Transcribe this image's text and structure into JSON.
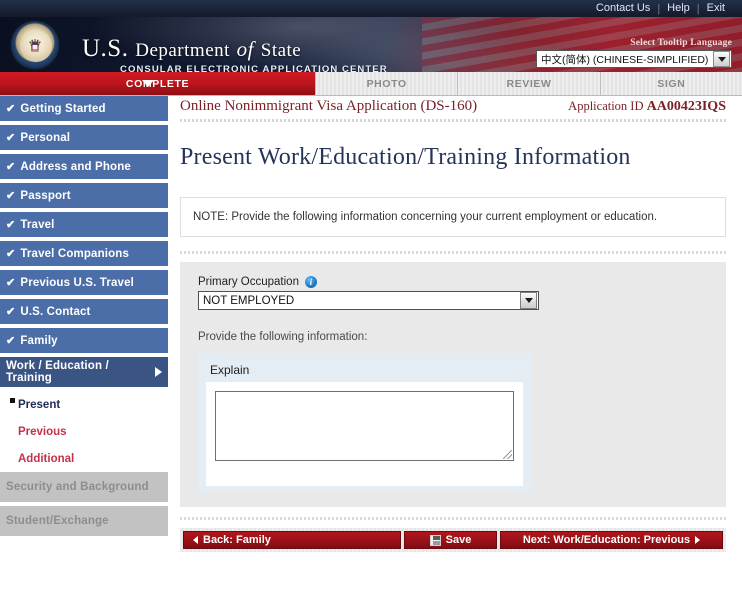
{
  "utility_links": [
    "Contact Us",
    "Help",
    "Exit"
  ],
  "banner": {
    "dept_us": "U.S.",
    "dept_department": "Department",
    "dept_of": "of",
    "dept_state": "State",
    "subtitle": "CONSULAR ELECTRONIC APPLICATION CENTER",
    "tooltip_language_label": "Select Tooltip Language",
    "tooltip_language_value": "中文(简体) (CHINESE-SIMPLIFIED)"
  },
  "stages": [
    {
      "label": "COMPLETE",
      "active": true
    },
    {
      "label": "PHOTO",
      "active": false
    },
    {
      "label": "REVIEW",
      "active": false
    },
    {
      "label": "SIGN",
      "active": false
    }
  ],
  "sidebar": {
    "items": [
      {
        "label": "Getting Started",
        "state": "complete"
      },
      {
        "label": "Personal",
        "state": "complete"
      },
      {
        "label": "Address and Phone",
        "state": "complete"
      },
      {
        "label": "Passport",
        "state": "complete"
      },
      {
        "label": "Travel",
        "state": "complete"
      },
      {
        "label": "Travel Companions",
        "state": "complete"
      },
      {
        "label": "Previous U.S. Travel",
        "state": "complete"
      },
      {
        "label": "U.S. Contact",
        "state": "complete"
      },
      {
        "label": "Family",
        "state": "complete"
      }
    ],
    "current_item": "Work / Education / Training",
    "sub_items": [
      {
        "label": "Present",
        "active": true
      },
      {
        "label": "Previous",
        "active": false
      },
      {
        "label": "Additional",
        "active": false
      }
    ],
    "disabled_items": [
      {
        "label": "Security and Background"
      },
      {
        "label": "Student/Exchange"
      }
    ],
    "check_glyph": "✔"
  },
  "content": {
    "app_title": "Online Nonimmigrant Visa Application (DS-160)",
    "app_id_label": "Application ID",
    "app_id_value": "AA00423IQS",
    "page_title": "Present Work/Education/Training Information",
    "note": "NOTE: Provide the following information concerning your current employment or education.",
    "primary_occupation_label": "Primary Occupation",
    "primary_occupation_value": "NOT EMPLOYED",
    "info_icon_glyph": "i",
    "provide_text": "Provide the following information:",
    "explain_label": "Explain",
    "explain_value": "",
    "explain_placeholder": ""
  },
  "buttons": {
    "back": "Back: Family",
    "save": "Save",
    "next": "Next: Work/Education: Previous"
  },
  "colors": {
    "brand_red": "#991117",
    "nav_blue": "#4c6ea8",
    "nav_blue_active": "#3a5584",
    "link_red": "#c2334b",
    "title_navy": "#253559"
  }
}
